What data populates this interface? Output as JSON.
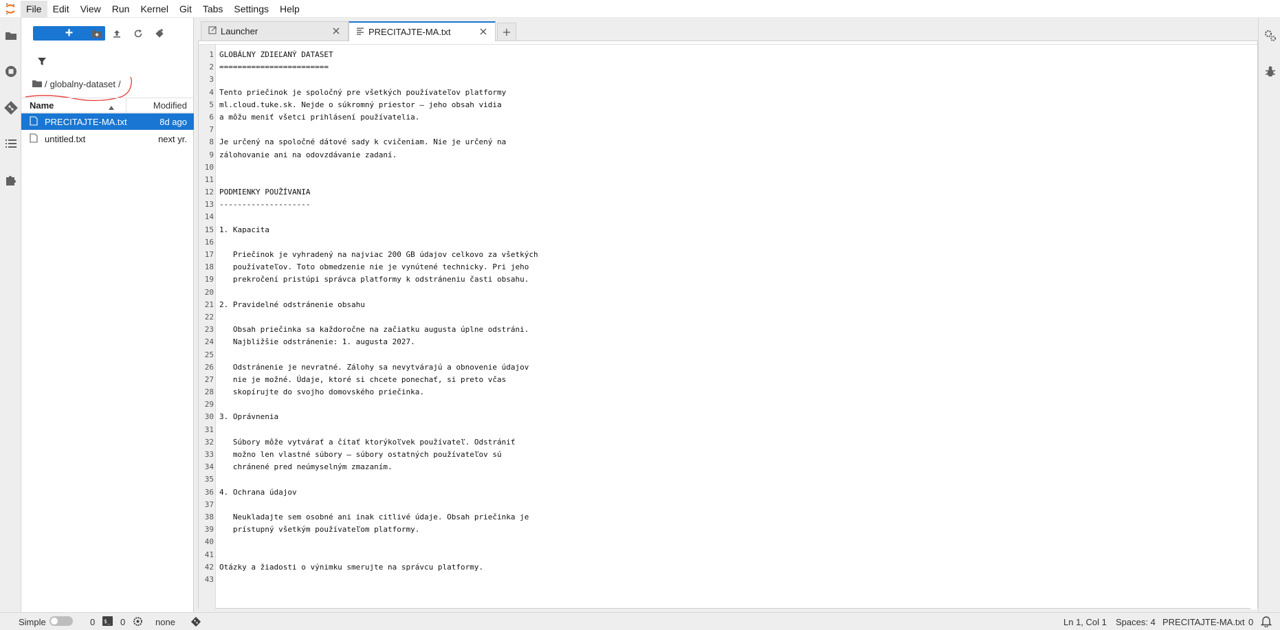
{
  "menu": [
    "File",
    "Edit",
    "View",
    "Run",
    "Kernel",
    "Git",
    "Tabs",
    "Settings",
    "Help"
  ],
  "filebrowser": {
    "new_label": "+",
    "breadcrumb": {
      "root": "/",
      "folder": "globalny-dataset",
      "trail": "/"
    },
    "columns": {
      "name": "Name",
      "modified": "Modified"
    },
    "files": [
      {
        "name": "PRECITAJTE-MA.txt",
        "modified": "8d ago"
      },
      {
        "name": "untitled.txt",
        "modified": "next yr."
      }
    ]
  },
  "tabs": [
    {
      "label": "Launcher"
    },
    {
      "label": "PRECITAJTE-MA.txt"
    }
  ],
  "editor": {
    "lines": [
      "GLOBÁLNY ZDIEĽANÝ DATASET",
      "========================",
      "",
      "Tento priečinok je spoločný pre všetkých používateľov platformy",
      "ml.cloud.tuke.sk. Nejde o súkromný priestor — jeho obsah vidia",
      "a môžu meniť všetci prihlásení používatelia.",
      "",
      "Je určený na spoločné dátové sady k cvičeniam. Nie je určený na",
      "zálohovanie ani na odovzdávanie zadaní.",
      "",
      "",
      "PODMIENKY POUŽÍVANIA",
      "--------------------",
      "",
      "1. Kapacita",
      "",
      "   Priečinok je vyhradený na najviac 200 GB údajov celkovo za všetkých",
      "   používateľov. Toto obmedzenie nie je vynútené technicky. Pri jeho",
      "   prekročení pristúpi správca platformy k odstráneniu časti obsahu.",
      "",
      "2. Pravidelné odstránenie obsahu",
      "",
      "   Obsah priečinka sa každoročne na začiatku augusta úplne odstráni.",
      "   Najbližšie odstránenie: 1. augusta 2027.",
      "",
      "   Odstránenie je nevratné. Zálohy sa nevytvárajú a obnovenie údajov",
      "   nie je možné. Údaje, ktoré si chcete ponechať, si preto včas",
      "   skopírujte do svojho domovského priečinka.",
      "",
      "3. Oprávnenia",
      "",
      "   Súbory môže vytvárať a čítať ktorýkoľvek používateľ. Odstrániť",
      "   možno len vlastné súbory — súbory ostatných používateľov sú",
      "   chránené pred neúmyselným zmazaním.",
      "",
      "4. Ochrana údajov",
      "",
      "   Neukladajte sem osobné ani inak citlivé údaje. Obsah priečinka je",
      "   prístupný všetkým používateľom platformy.",
      "",
      "",
      "Otázky a žiadosti o výnimku smerujte na správcu platformy.",
      ""
    ]
  },
  "statusbar": {
    "mode": "Simple",
    "kernels": "0",
    "terminals": "0",
    "kernel_status": "none",
    "cursor": "Ln 1, Col 1",
    "spaces": "Spaces: 4",
    "filename": "PRECITAJTE-MA.txt",
    "notifications": "0"
  },
  "colors": {
    "accent": "#1976d2",
    "annotation": "#e53935"
  }
}
